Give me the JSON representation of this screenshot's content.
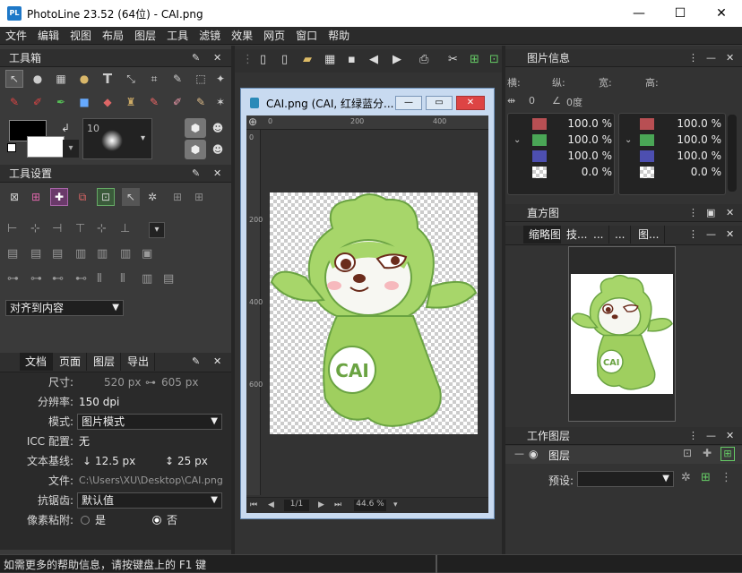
{
  "window": {
    "title": "PhotoLine 23.52 (64位) - CAI.png",
    "logo": "PL"
  },
  "menu": [
    "文件",
    "编辑",
    "视图",
    "布局",
    "图层",
    "工具",
    "滤镜",
    "效果",
    "网页",
    "窗口",
    "帮助"
  ],
  "toolbox": {
    "title": "工具箱",
    "brush_size": "10"
  },
  "tool_settings": {
    "title": "工具设置",
    "align_dropdown": "对齐到内容"
  },
  "doc_panel": {
    "tabs": [
      "文档",
      "页面",
      "图层",
      "导出"
    ],
    "size_label": "尺寸:",
    "size_w": "520 px",
    "size_h": "605 px",
    "res_label": "分辨率:",
    "res_value": "150 dpi",
    "mode_label": "模式:",
    "mode_value": "图片模式",
    "icc_label": "ICC 配置:",
    "icc_value": "无",
    "baseline_label": "文本基线:",
    "baseline_a": "12.5 px",
    "baseline_b": "25 px",
    "file_label": "文件:",
    "file_value": "C:\\Users\\XU\\Desktop\\CAI.png",
    "aa_label": "抗锯齿:",
    "aa_value": "默认值",
    "snap_label": "像素粘附:",
    "snap_yes": "是",
    "snap_no": "否"
  },
  "document": {
    "title": "CAI.png (CAI, 红绿蓝分...",
    "ruler_h": [
      "0",
      "200",
      "400"
    ],
    "ruler_v": [
      "0",
      "200",
      "400",
      "600"
    ],
    "page": "1/1",
    "zoom": "44.6 %",
    "logo_text": "CAI"
  },
  "image_info": {
    "title": "图片信息",
    "coords": [
      "横:",
      "纵:",
      "宽:",
      "高:"
    ],
    "offset": "0",
    "angle": "0度",
    "left_pcts": [
      "100.0 %",
      "100.0 %",
      "100.0 %",
      "0.0 %"
    ],
    "right_pcts": [
      "100.0 %",
      "100.0 %",
      "100.0 %",
      "0.0 %"
    ],
    "colors": {
      "red": "#b84f53",
      "green": "#4aa656",
      "blue": "#4d4fb0"
    }
  },
  "histogram": {
    "title": "直方图"
  },
  "thumbnail": {
    "tabs": [
      "缩略图",
      "技...",
      "...",
      "...",
      "图..."
    ]
  },
  "layers": {
    "title": "工作图层",
    "layer_name": "图层",
    "preset_label": "预设:"
  },
  "status": {
    "text": "如需更多的帮助信息，请按键盘上的 F1 键"
  }
}
